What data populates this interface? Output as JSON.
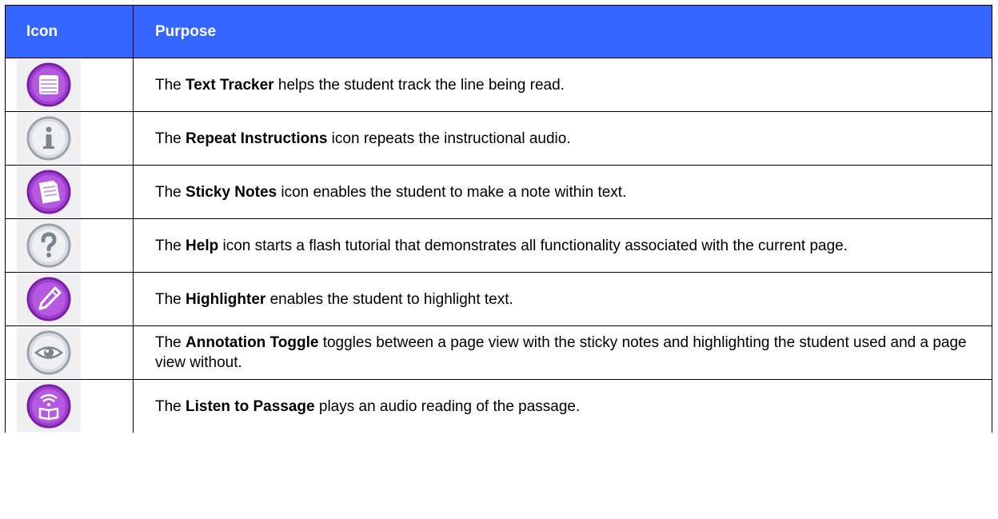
{
  "table": {
    "header_icon": "Icon",
    "header_purpose": "Purpose",
    "rows": [
      {
        "icon": "text-tracker-icon",
        "pre": "The ",
        "term": "Text Tracker",
        "post": " helps the student track the line being read."
      },
      {
        "icon": "info-icon",
        "pre": "The ",
        "term": "Repeat Instructions",
        "post": " icon repeats the instructional audio."
      },
      {
        "icon": "sticky-notes-icon",
        "pre": "The ",
        "term": "Sticky Notes",
        "post": " icon enables the student to make a note within text."
      },
      {
        "icon": "help-icon",
        "pre": "The ",
        "term": "Help",
        "post": " icon starts a flash tutorial that demonstrates all functionality associated with the current page."
      },
      {
        "icon": "highlighter-icon",
        "pre": "The ",
        "term": "Highlighter",
        "post": " enables the student to highlight text."
      },
      {
        "icon": "eye-icon",
        "pre": "The ",
        "term": "Annotation Toggle",
        "post": " toggles between a page view with the sticky notes and highlighting the student used and a page view without."
      },
      {
        "icon": "listen-icon",
        "pre": "The ",
        "term": "Listen to Passage",
        "post": " plays an audio reading of the passage."
      }
    ]
  },
  "colors": {
    "header_bg": "#3366ff",
    "purple_icon": "#9933cc",
    "gray_icon": "#a8b0b8"
  }
}
